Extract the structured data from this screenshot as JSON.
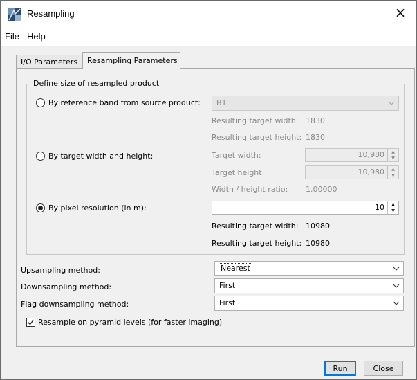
{
  "window": {
    "title": "Resampling",
    "close_glyph": "×"
  },
  "menu": {
    "items": [
      "File",
      "Help"
    ]
  },
  "tabs": [
    "I/O Parameters",
    "Resampling Parameters"
  ],
  "group": {
    "title": "Define size of resampled product",
    "ref_band": {
      "label": "By reference band from source product:",
      "selected": false,
      "band_value": "B1",
      "width_label": "Resulting target width:",
      "width_value": "1830",
      "height_label": "Resulting target height:",
      "height_value": "1830"
    },
    "target_wh": {
      "label": "By target width and height:",
      "selected": false,
      "width_label": "Target width:",
      "width_value": "10,980",
      "height_label": "Target height:",
      "height_value": "10,980",
      "ratio_label": "Width / height ratio:",
      "ratio_value": "1.00000"
    },
    "pixel_res": {
      "label": "By pixel resolution (in m):",
      "selected": true,
      "value": "10",
      "width_label": "Resulting target width:",
      "width_value": "10980",
      "height_label": "Resulting target height:",
      "height_value": "10980"
    }
  },
  "methods": {
    "upsampling_label": "Upsampling method:",
    "upsampling_value": "Nearest",
    "downsampling_label": "Downsampling method:",
    "downsampling_value": "First",
    "flag_label": "Flag downsampling method:",
    "flag_value": "First"
  },
  "pyramid": {
    "label": "Resample on pyramid levels (for faster imaging)",
    "checked": true
  },
  "buttons": {
    "run": "Run",
    "close": "Close"
  }
}
